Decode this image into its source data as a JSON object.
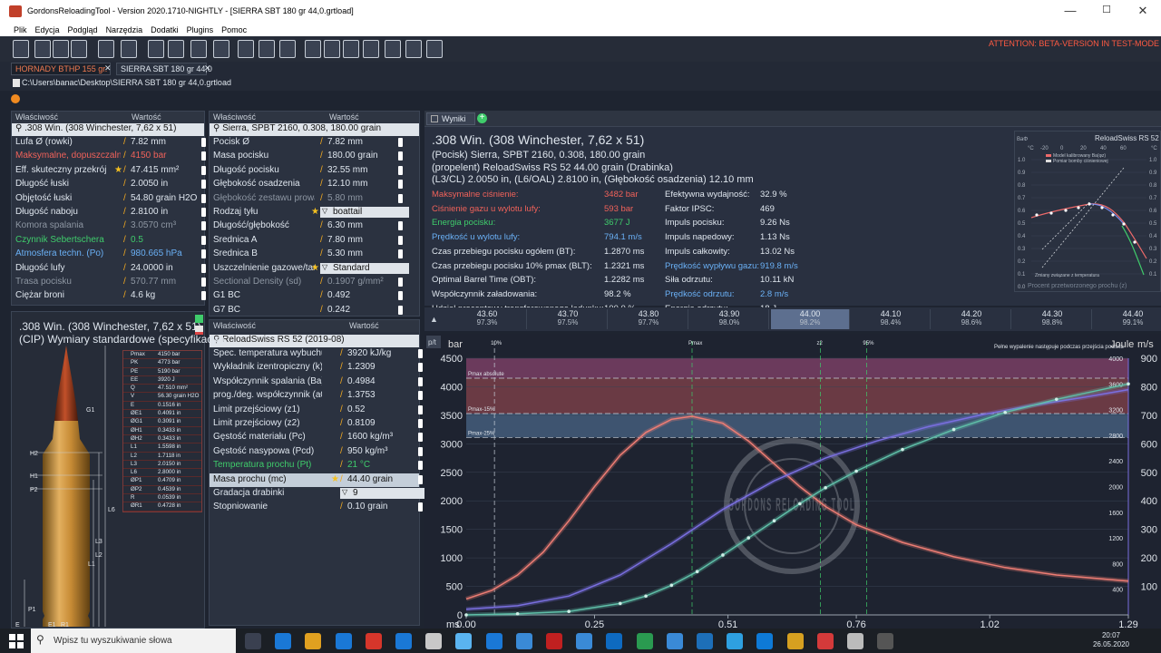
{
  "window": {
    "title": "GordonsReloadingTool - Version 2020.1710-NIGHTLY - [SIERRA SBT 180 gr  44,0.grtload]",
    "minimize": "—",
    "maximize": "☐",
    "close": "✕"
  },
  "menu": [
    "Plik",
    "Edycja",
    "Podgląd",
    "Narzędzia",
    "Dodatki",
    "Plugins",
    "Pomoc"
  ],
  "attention": "ATTENTION: BETA-VERSION IN TEST-MODE",
  "tabs": {
    "tab1": "HORNADY BTHP 155 gr.",
    "tab2": "SIERRA SBT 180 gr  44,0",
    "close": "✕"
  },
  "path": "C:\\Users\\banac\\Desktop\\SIERRA SBT 180 gr  44,0.grtload",
  "cartridge_panel": {
    "h_prop": "Właściwość",
    "h_val": "Wartość",
    "selected": ".308 Win. (308 Winchester, 7,62 x 51)",
    "rows": [
      {
        "label": "Lufa Ø (rowki)",
        "value": "7.82 mm",
        "c": ""
      },
      {
        "label": "Maksymalne, dopuszczalne ciśn",
        "value": "4150 bar",
        "c": "red"
      },
      {
        "label": "Eff. skuteczny przekrój",
        "value": "47.415 mm²",
        "c": "",
        "star": true
      },
      {
        "label": "Długość łuski",
        "value": "2.0050 in",
        "c": ""
      },
      {
        "label": "Objętość łuski",
        "value": "54.80 grain H2O",
        "c": ""
      },
      {
        "label": "Długość naboju",
        "value": "2.8100 in",
        "c": ""
      },
      {
        "label": "Komora spalania",
        "value": "3.0570 cm³",
        "c": "gray"
      },
      {
        "label": "Czynnik Sebertschera",
        "value": "0.5",
        "c": "green"
      },
      {
        "label": "Atmosfera techn. (Po)",
        "value": "980.665 hPa",
        "c": "blue"
      },
      {
        "label": "Długość lufy",
        "value": "24.0000 in",
        "c": ""
      },
      {
        "label": "Trasa pocisku",
        "value": "570.77 mm",
        "c": "gray"
      },
      {
        "label": "Ciężar broni",
        "value": "4.6 kg",
        "c": ""
      }
    ]
  },
  "bullet_panel": {
    "h_prop": "Właściwość",
    "h_val": "Wartość",
    "selected": "Sierra, SPBT 2160, 0.308, 180.00 grain",
    "rows": [
      {
        "label": "Pocisk Ø",
        "value": "7.82 mm",
        "c": ""
      },
      {
        "label": "Masa pocisku",
        "value": "180.00 grain",
        "c": ""
      },
      {
        "label": "Długość pocisku",
        "value": "32.55 mm",
        "c": ""
      },
      {
        "label": "Głębokość osadzenia",
        "value": "12.10 mm",
        "c": ""
      },
      {
        "label": "Głębokość zestawu prowadzącego",
        "value": "5.80 mm",
        "c": "gray"
      },
      {
        "label": "Rodzaj tyłu",
        "value": "boattail",
        "c": "dd",
        "star": true
      },
      {
        "label": "Długość/głębokość",
        "value": "6.30 mm",
        "c": ""
      },
      {
        "label": "Średnica A",
        "value": "7.80 mm",
        "c": ""
      },
      {
        "label": "Średnica B",
        "value": "5.30 mm",
        "c": ""
      },
      {
        "label": "Uszczelnienie gazowe/tarcie",
        "value": "Standard",
        "c": "dd",
        "star": true
      },
      {
        "label": "Sectional Density (sd)",
        "value": "0.1907 g/mm²",
        "c": "gray"
      },
      {
        "label": "G1 BC",
        "value": "0.492",
        "c": ""
      },
      {
        "label": "G7 BC",
        "value": "0.242",
        "c": ""
      }
    ]
  },
  "powder_panel": {
    "h_prop": "Właściwość",
    "h_val": "Wartość",
    "selected": "ReloadSwiss RS 52 (2019-08)",
    "rows": [
      {
        "label": "Spec. temperatura wybuchu (Qex)",
        "value": "3920 kJ/kg",
        "c": ""
      },
      {
        "label": "Wykładnik izentropiczny (k)",
        "value": "1.2309",
        "c": ""
      },
      {
        "label": "Współczynnik spalania (Ba)",
        "value": "0.4984",
        "c": ""
      },
      {
        "label": "prog./deg. współczynnik (a0)",
        "value": "1.3753",
        "c": ""
      },
      {
        "label": "Limit przejściowy (z1)",
        "value": "0.52",
        "c": ""
      },
      {
        "label": "Limit przejściowy (z2)",
        "value": "0.8109",
        "c": ""
      },
      {
        "label": "Gęstość materiału (Pc)",
        "value": "1600 kg/m³",
        "c": ""
      },
      {
        "label": "Gęstość nasypowa (Pcd)",
        "value": "950 kg/m³",
        "c": ""
      },
      {
        "label": "Temperatura prochu (Pt)",
        "value": "21 °C",
        "c": "green"
      },
      {
        "label": "Masa prochu (mc)",
        "value": "44.40 grain",
        "c": "hl",
        "star": true
      },
      {
        "label": "Gradacja drabinki",
        "value": "9",
        "c": "dd"
      },
      {
        "label": "Stopniowanie",
        "value": "0.10 grain",
        "c": ""
      }
    ]
  },
  "drawing": {
    "title1": ".308 Win. (308 Winchester, 7,62 x 51)",
    "title2": "(CIP) Wymiary standardowe (specyfikacje)",
    "specs": [
      [
        "Pmax",
        "4150 bar"
      ],
      [
        "PK",
        "4773 bar"
      ],
      [
        "PE",
        "5190 bar"
      ],
      [
        "EE",
        "3920 J"
      ],
      [
        "Q",
        "47.510 mm²"
      ],
      [
        "V",
        "56.30 grain H2O"
      ],
      [
        "E",
        "0.1516 in"
      ],
      [
        "ØE1",
        "0.4091 in"
      ],
      [
        "ØG1",
        "0.3091 in"
      ],
      [
        "ØH1",
        "0.3433 in"
      ],
      [
        "ØH2",
        "0.3433 in"
      ],
      [
        "L1",
        "1.5598 in"
      ],
      [
        "L2",
        "1.7118 in"
      ],
      [
        "L3",
        "2.0150 in"
      ],
      [
        "L6",
        "2.8000 in"
      ],
      [
        "ØP1",
        "0.4709 in"
      ],
      [
        "ØP2",
        "0.4539 in"
      ],
      [
        "R",
        "0.0539 in"
      ],
      [
        "ØR1",
        "0.4728 in"
      ]
    ],
    "dims": [
      "G1",
      "H2",
      "H1",
      "P2",
      "L6",
      "L3",
      "L2",
      "L1",
      "P1",
      "E1",
      "R1",
      "E"
    ]
  },
  "results": {
    "tab": "Wyniki",
    "title": ".308 Win. (308 Winchester, 7,62 x 51)",
    "lines": [
      "(Pocisk) Sierra, SPBT 2160, 0.308, 180.00 grain",
      "(propelent) ReloadSwiss RS 52 44.00 grain (Drabinka)",
      "(L3/CL) 2.0050 in, (L6/OAL) 2.8100 in, (Głębokość osadzenia) 12.10 mm"
    ],
    "left": [
      [
        "Maksymalne ciśnienie:",
        "3482 bar",
        "red"
      ],
      [
        "Ciśnienie gazu u wylotu lufy:",
        "593 bar",
        "red"
      ],
      [
        "Energia pocisku:",
        "3677 J",
        "green"
      ],
      [
        "Prędkość u wylotu lufy:",
        "794.1 m/s",
        "blue"
      ],
      [
        "Czas przebiegu pocisku ogółem (BT):",
        "1.2870 ms",
        ""
      ],
      [
        "Czas przebiegu pocisku 10% pmax (BLT):",
        "1.2321 ms",
        ""
      ],
      [
        "Optimal Barrel Time (OBT):",
        "1.2282 ms",
        ""
      ],
      [
        "Współczynnik załadowania:",
        "98.2 %",
        ""
      ],
      [
        "Udział procentowy transferowanego ładunku:",
        "100.0 %",
        ""
      ]
    ],
    "right": [
      [
        "Efektywna wydajność:",
        "32.9 %",
        ""
      ],
      [
        "Faktor IPSC:",
        "469",
        ""
      ],
      [
        "Impuls pocisku:",
        "9.26 Ns",
        ""
      ],
      [
        "Impuls napedowy:",
        "1.13 Ns",
        ""
      ],
      [
        "Impuls całkowity:",
        "13.02 Ns",
        ""
      ],
      [
        "Prędkość wypływu gazu:",
        "919.8 m/s",
        "blue"
      ],
      [
        "Siła odrzutu:",
        "10.11 kN",
        ""
      ],
      [
        "Prędkość odrzutu:",
        "2.8 m/s",
        "blue"
      ],
      [
        "Energia odrzutu:",
        "18 J",
        ""
      ]
    ]
  },
  "mini_chart": {
    "title": "ReloadSwiss RS 52",
    "legend1": "Model kalibrowany Ba(φz)",
    "legend2": "Pomiar bomby ciśnieniowej",
    "foot": "Procent przetworzonego prochu (z)",
    "note": "Zmiany związane z temperatura",
    "yleft": "BaΦ",
    "tleft": "°C",
    "tright": "°C",
    "toplabels": [
      "-20",
      "0",
      "20",
      "40",
      "60"
    ],
    "ylabels": [
      "1.0",
      "0.9",
      "0.8",
      "0.7",
      "0.6",
      "0.5",
      "0.4",
      "0.3",
      "0.2",
      "0.1",
      "0.0"
    ],
    "rlabels": [
      "1.0",
      "0.9",
      "0.8",
      "0.7",
      "0.6",
      "0.5",
      "0.4",
      "0.3",
      "0.2",
      "0.1"
    ]
  },
  "ladder": [
    [
      "43.60",
      "97.3%"
    ],
    [
      "43.70",
      "97.5%"
    ],
    [
      "43.80",
      "97.7%"
    ],
    [
      "43.90",
      "98.0%"
    ],
    [
      "44.00",
      "98.2%"
    ],
    [
      "44.10",
      "98.4%"
    ],
    [
      "44.20",
      "98.6%"
    ],
    [
      "44.30",
      "98.8%"
    ],
    [
      "44.40",
      "99.1%"
    ]
  ],
  "ladder_active": 4,
  "chart_data": {
    "type": "line",
    "xlabel": "ms",
    "ylabel": "bar",
    "y2label": "Joule",
    "y3label": "m/s",
    "x_ticks": [
      0,
      0.25,
      0.51,
      0.76,
      1.02,
      1.29
    ],
    "x_tick_labels": [
      "0.00",
      "0.25",
      "0.51",
      "0.76",
      "1.02",
      "1.29"
    ],
    "ylim": [
      0,
      4500
    ],
    "y_ticks": [
      0,
      500,
      1000,
      1500,
      2000,
      2500,
      3000,
      3500,
      4000,
      4500
    ],
    "y2_ticks": [
      400,
      800,
      1200,
      1600,
      2000,
      2400,
      2800,
      3200,
      3600,
      4000
    ],
    "y3_ticks": [
      100,
      200,
      300,
      400,
      500,
      600,
      700,
      800,
      900
    ],
    "bands": [
      {
        "name": "Pmax absolute",
        "y": 4150
      },
      {
        "name": "Pmax-15%",
        "y": 3530
      },
      {
        "name": "Pmax-25%",
        "y": 3110
      }
    ],
    "markers": [
      {
        "label": "10%",
        "x": 0.055
      },
      {
        "label": "Pmax",
        "x": 0.44
      },
      {
        "label": "z2",
        "x": 0.69
      },
      {
        "label": "95%",
        "x": 0.78
      }
    ],
    "note": "Pełne wypalenie następuje podczas przejścia pocisku",
    "watermark": "GORDONS RELOADING TOOL",
    "series": [
      {
        "name": "",
        "color": "#ee7d74",
        "x": [
          0,
          0.05,
          0.1,
          0.15,
          0.2,
          0.25,
          0.3,
          0.35,
          0.4,
          0.44,
          0.5,
          0.55,
          0.6,
          0.65,
          0.7,
          0.76,
          0.85,
          0.95,
          1.05,
          1.15,
          1.29
        ],
        "y": [
          280,
          430,
          700,
          1100,
          1650,
          2250,
          2800,
          3200,
          3430,
          3482,
          3360,
          3050,
          2650,
          2250,
          1900,
          1580,
          1270,
          1020,
          830,
          700,
          593
        ]
      },
      {
        "name": "",
        "color": "#7a6fe0",
        "x": [
          0,
          0.1,
          0.2,
          0.3,
          0.4,
          0.5,
          0.6,
          0.7,
          0.8,
          0.9,
          1.0,
          1.1,
          1.2,
          1.29
        ],
        "y": [
          100,
          160,
          330,
          700,
          1250,
          1850,
          2350,
          2750,
          3050,
          3300,
          3500,
          3670,
          3810,
          3950
        ]
      },
      {
        "name": "",
        "color": "#5fbfa8",
        "x": [
          0,
          0.1,
          0.2,
          0.3,
          0.35,
          0.4,
          0.45,
          0.5,
          0.55,
          0.6,
          0.65,
          0.7,
          0.76,
          0.85,
          0.95,
          1.05,
          1.15,
          1.29
        ],
        "y": [
          0,
          20,
          60,
          200,
          330,
          520,
          760,
          1050,
          1350,
          1650,
          1950,
          2230,
          2520,
          2900,
          3250,
          3550,
          3780,
          4050
        ]
      }
    ]
  },
  "taskbar": {
    "search": "Wpisz tu wyszukiwanie słowa",
    "time": "20:07",
    "date": "26.05.2020"
  }
}
